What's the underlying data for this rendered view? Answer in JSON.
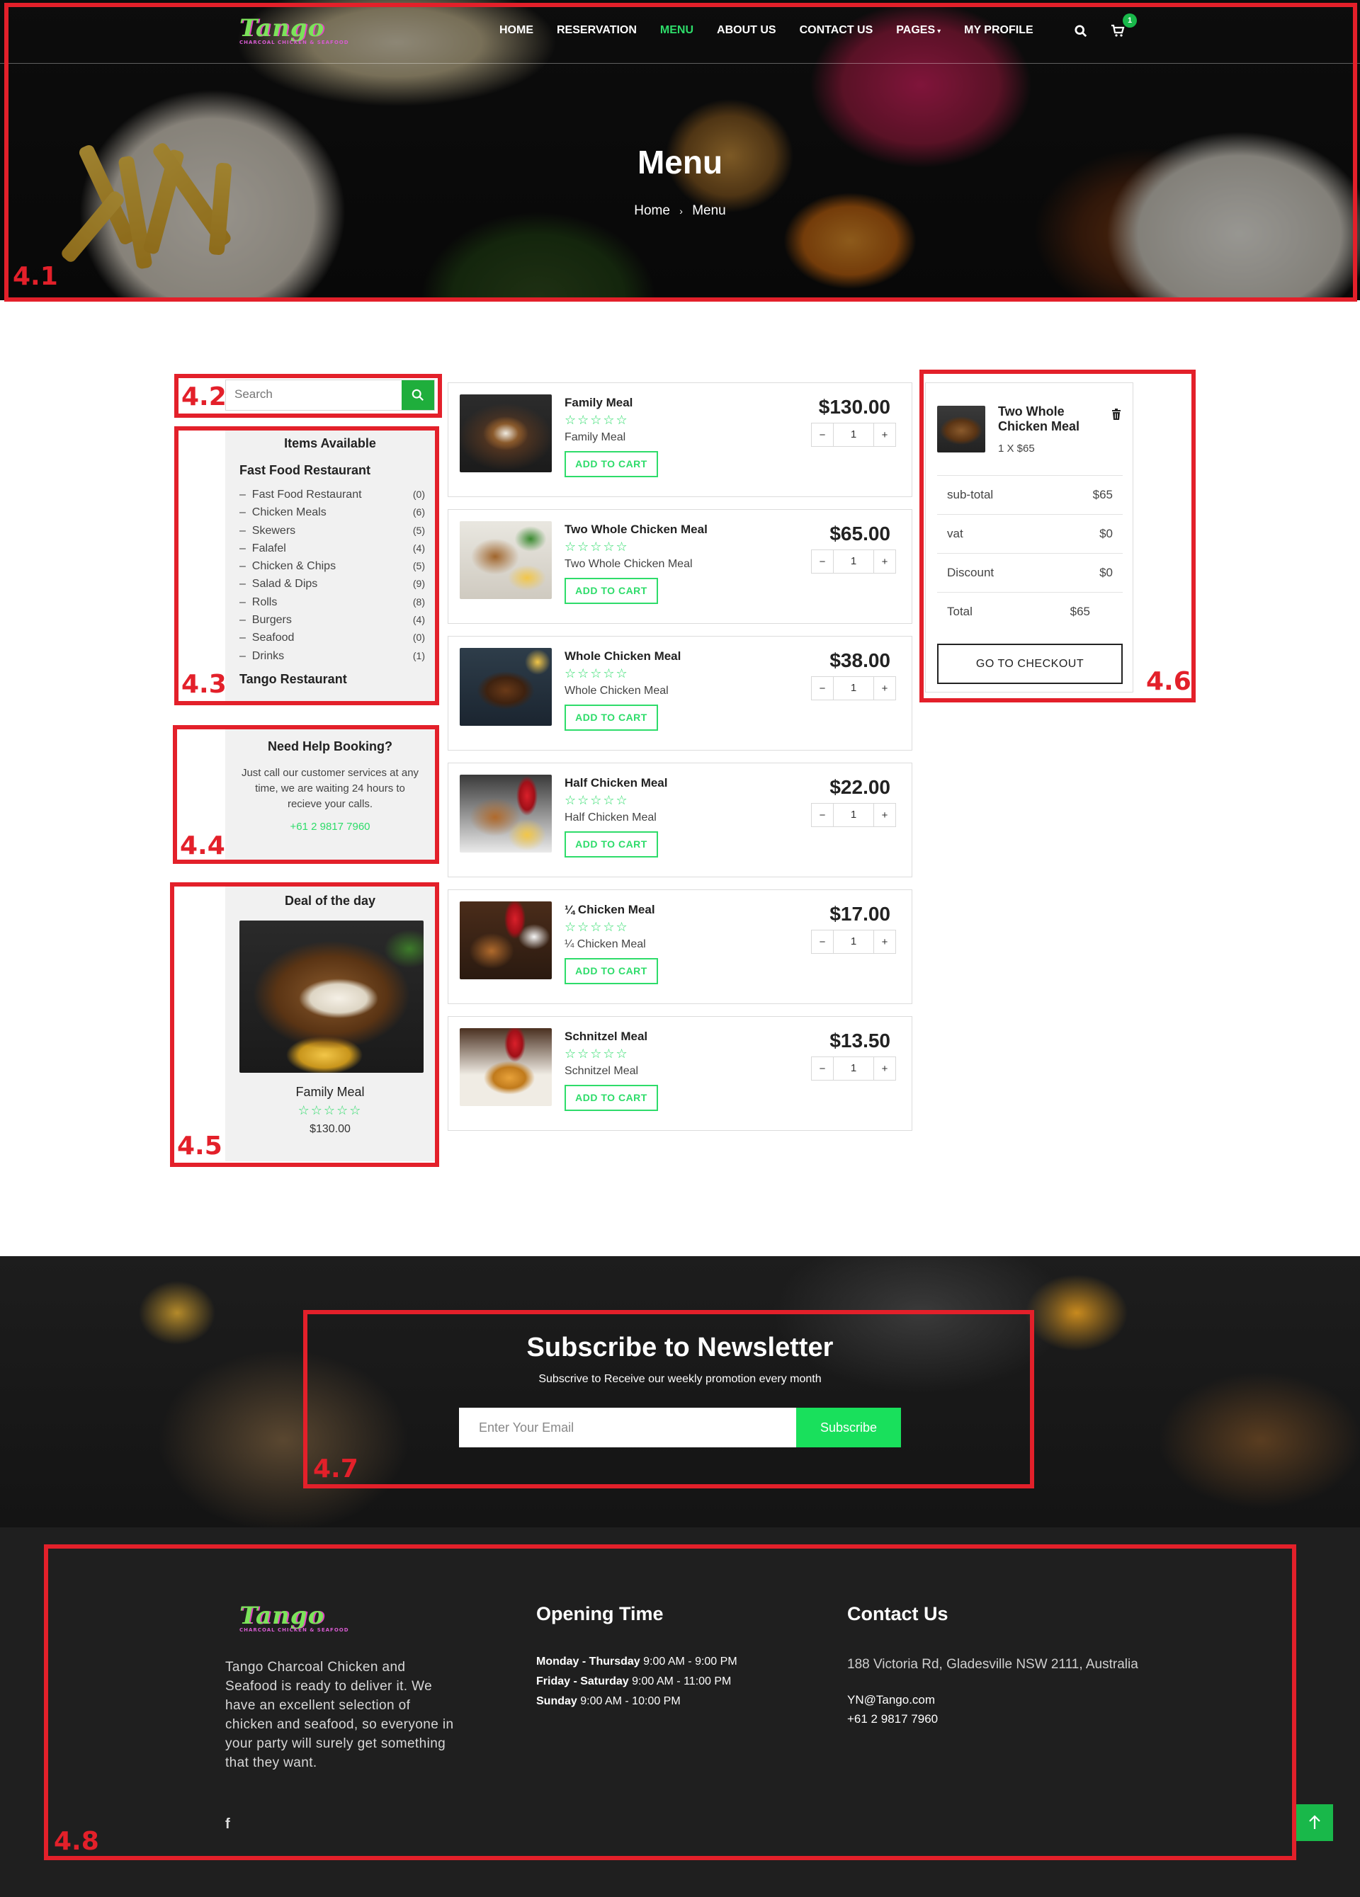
{
  "brand": {
    "logo_text": "Tango",
    "logo_sub": "CHARCOAL CHICKEN & SEAFOOD"
  },
  "nav": {
    "items": [
      "HOME",
      "RESERVATION",
      "MENU",
      "ABOUT US",
      "CONTACT US",
      "PAGES",
      "MY PROFILE"
    ],
    "active": "MENU",
    "cart_count": "1",
    "accent_color": "#2edc6a"
  },
  "hero": {
    "title": "Menu",
    "breadcrumb_home": "Home",
    "breadcrumb_sep": "›",
    "breadcrumb_current": "Menu"
  },
  "search": {
    "placeholder": "Search"
  },
  "categories": {
    "title": "Items Available",
    "group1": "Fast Food Restaurant",
    "items": [
      {
        "label": "Fast Food Restaurant",
        "count": "(0)"
      },
      {
        "label": "Chicken Meals",
        "count": "(6)"
      },
      {
        "label": "Skewers",
        "count": "(5)"
      },
      {
        "label": "Falafel",
        "count": "(4)"
      },
      {
        "label": "Chicken & Chips",
        "count": "(5)"
      },
      {
        "label": "Salad & Dips",
        "count": "(9)"
      },
      {
        "label": "Rolls",
        "count": "(8)"
      },
      {
        "label": "Burgers",
        "count": "(4)"
      },
      {
        "label": "Seafood",
        "count": "(0)"
      },
      {
        "label": "Drinks",
        "count": "(1)"
      }
    ],
    "group2": "Tango Restaurant"
  },
  "help": {
    "title": "Need Help Booking?",
    "text": "Just call our customer services at any time, we are waiting 24 hours to recieve your calls.",
    "phone": "+61 2 9817 7960"
  },
  "deal": {
    "title": "Deal of the day",
    "name": "Family Meal",
    "stars": "☆☆☆☆☆",
    "price": "$130.00"
  },
  "products": [
    {
      "name": "Family Meal",
      "sub": "Family Meal",
      "price": "$130.00",
      "qty": "1",
      "stars": "☆☆☆☆☆",
      "button": "ADD TO CART"
    },
    {
      "name": "Two Whole Chicken Meal",
      "sub": "Two Whole Chicken Meal",
      "price": "$65.00",
      "qty": "1",
      "stars": "☆☆☆☆☆",
      "button": "ADD TO CART"
    },
    {
      "name": "Whole Chicken Meal",
      "sub": "Whole Chicken Meal",
      "price": "$38.00",
      "qty": "1",
      "stars": "☆☆☆☆☆",
      "button": "ADD TO CART"
    },
    {
      "name": "Half Chicken Meal",
      "sub": "Half Chicken Meal",
      "price": "$22.00",
      "qty": "1",
      "stars": "☆☆☆☆☆",
      "button": "ADD TO CART"
    },
    {
      "name": "¼ Chicken Meal",
      "sub": "¼ Chicken Meal",
      "price": "$17.00",
      "qty": "1",
      "stars": "☆☆☆☆☆",
      "button": "ADD TO CART"
    },
    {
      "name": "Schnitzel Meal",
      "sub": "Schnitzel Meal",
      "price": "$13.50",
      "qty": "1",
      "stars": "☆☆☆☆☆",
      "button": "ADD TO CART"
    }
  ],
  "cart": {
    "item_name": "Two Whole Chicken Meal",
    "item_qty": "1 X $65",
    "rows": [
      {
        "label": "sub-total",
        "value": "$65"
      },
      {
        "label": "vat",
        "value": "$0"
      },
      {
        "label": "Discount",
        "value": "$0"
      },
      {
        "label": "Total",
        "value": "$65"
      }
    ],
    "checkout": "GO TO CHECKOUT"
  },
  "newsletter": {
    "title": "Subscribe to Newsletter",
    "subtitle": "Subscrive to Receive our weekly promotion every month",
    "placeholder": "Enter Your Email",
    "button": "Subscribe"
  },
  "footer": {
    "about": "Tango Charcoal Chicken and Seafood is ready to deliver it. We have an excellent selection of chicken and seafood, so everyone in your party will surely get something that they want.",
    "opening_title": "Opening Time",
    "hours": [
      {
        "days": "Monday - Thursday",
        "time": "9:00 AM - 9:00 PM"
      },
      {
        "days": "Friday - Saturday",
        "time": " 9:00 AM - 11:00 PM"
      },
      {
        "days": "Sunday",
        "time": "9:00 AM - 10:00 PM"
      }
    ],
    "contact_title": "Contact Us",
    "address": "188 Victoria Rd, Gladesville NSW 2111, Australia",
    "email": "YN@Tango.com",
    "phone": "+61 2 9817 7960"
  },
  "annotations": [
    "4.1",
    "4.2",
    "4.3",
    "4.4",
    "4.5",
    "4.6",
    "4.7",
    "4.8"
  ]
}
